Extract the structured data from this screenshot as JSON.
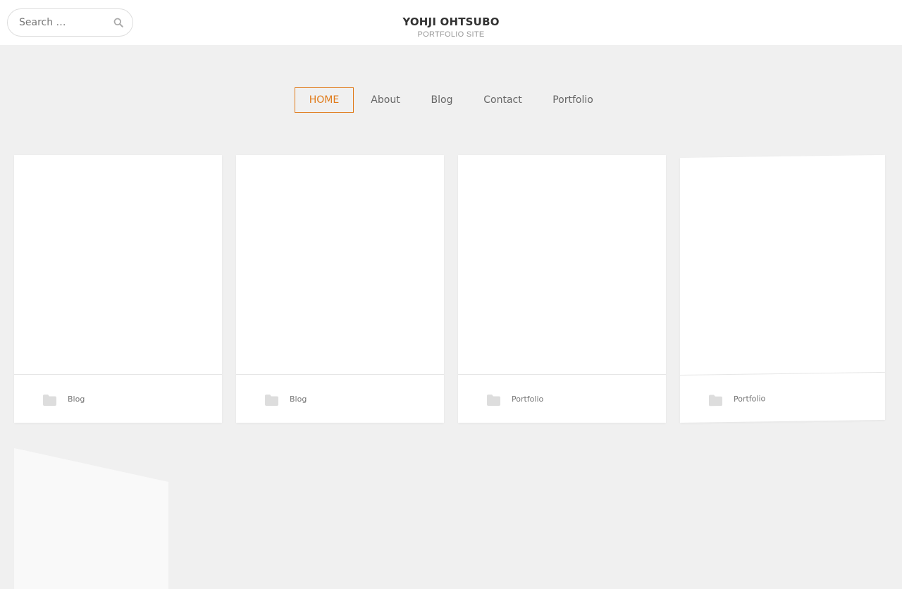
{
  "search": {
    "placeholder": "Search …",
    "icon": "search-icon"
  },
  "site": {
    "title": "YOHJI OHTSUBO",
    "tagline": "PORTFOLIO SITE"
  },
  "nav": {
    "items": [
      {
        "label": "HOME",
        "active": true
      },
      {
        "label": "About"
      },
      {
        "label": "Blog"
      },
      {
        "label": "Contact"
      },
      {
        "label": "Portfolio"
      }
    ]
  },
  "colors": {
    "accent": "#e07b1a",
    "background": "#f0f0f0"
  },
  "posts": [
    {
      "category": "Blog",
      "icon": "folder-icon"
    },
    {
      "category": "Blog",
      "icon": "folder-icon"
    },
    {
      "category": "Portfolio",
      "icon": "folder-icon"
    },
    {
      "category": "Portfolio",
      "icon": "folder-icon"
    }
  ]
}
